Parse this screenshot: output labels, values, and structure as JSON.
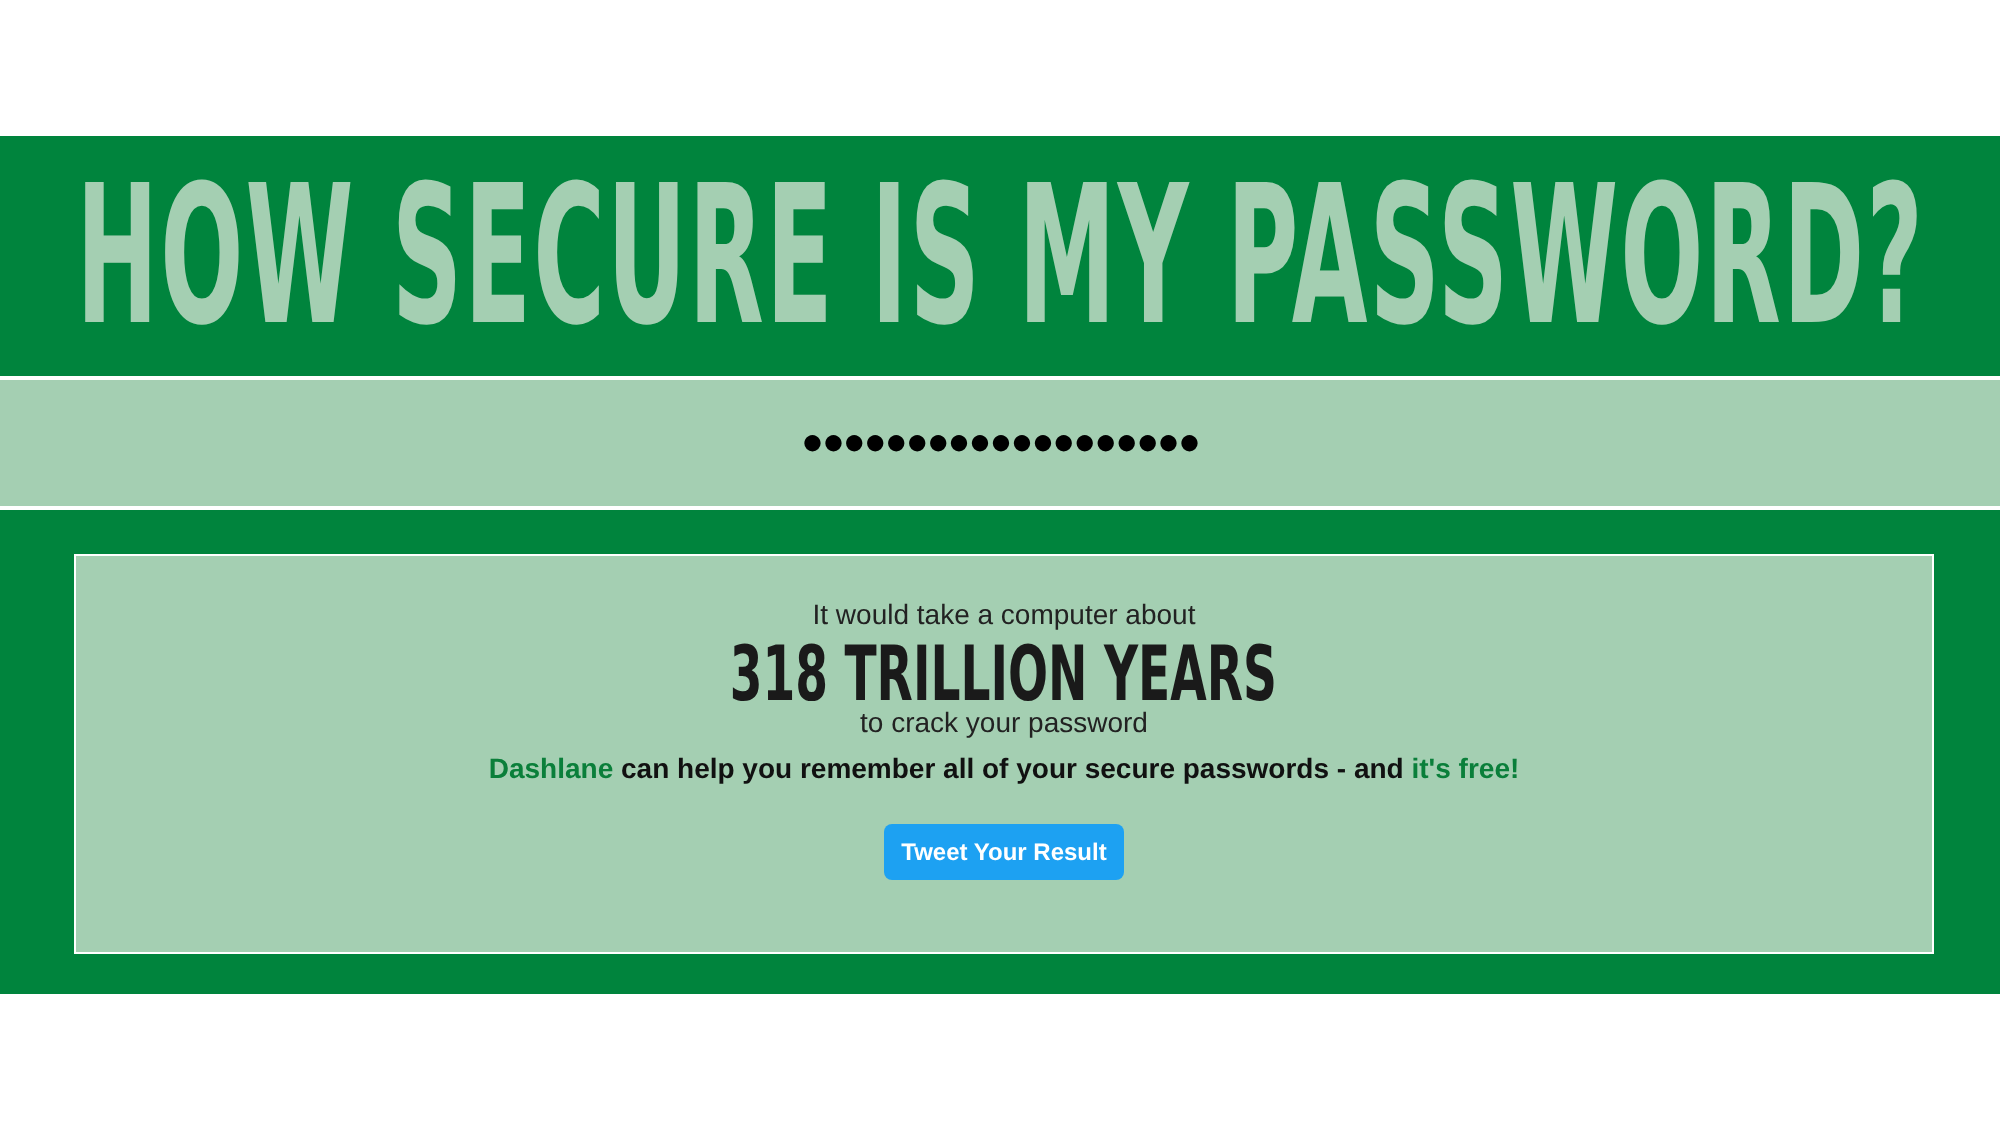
{
  "title": "HOW SECURE IS MY PASSWORD?",
  "password": {
    "value": "●●●●●●●●●●●●●●●●●●●"
  },
  "result": {
    "intro": "It would take a computer about",
    "time": "318 TRILLION YEARS",
    "outro": "to crack your password",
    "promo": [
      {
        "kind": "link",
        "text": "Dashlane"
      },
      {
        "kind": "text",
        "text": " can help you remember all of your secure passwords - and "
      },
      {
        "kind": "link",
        "text": "it's free!"
      }
    ],
    "button": "Tweet Your Result"
  }
}
